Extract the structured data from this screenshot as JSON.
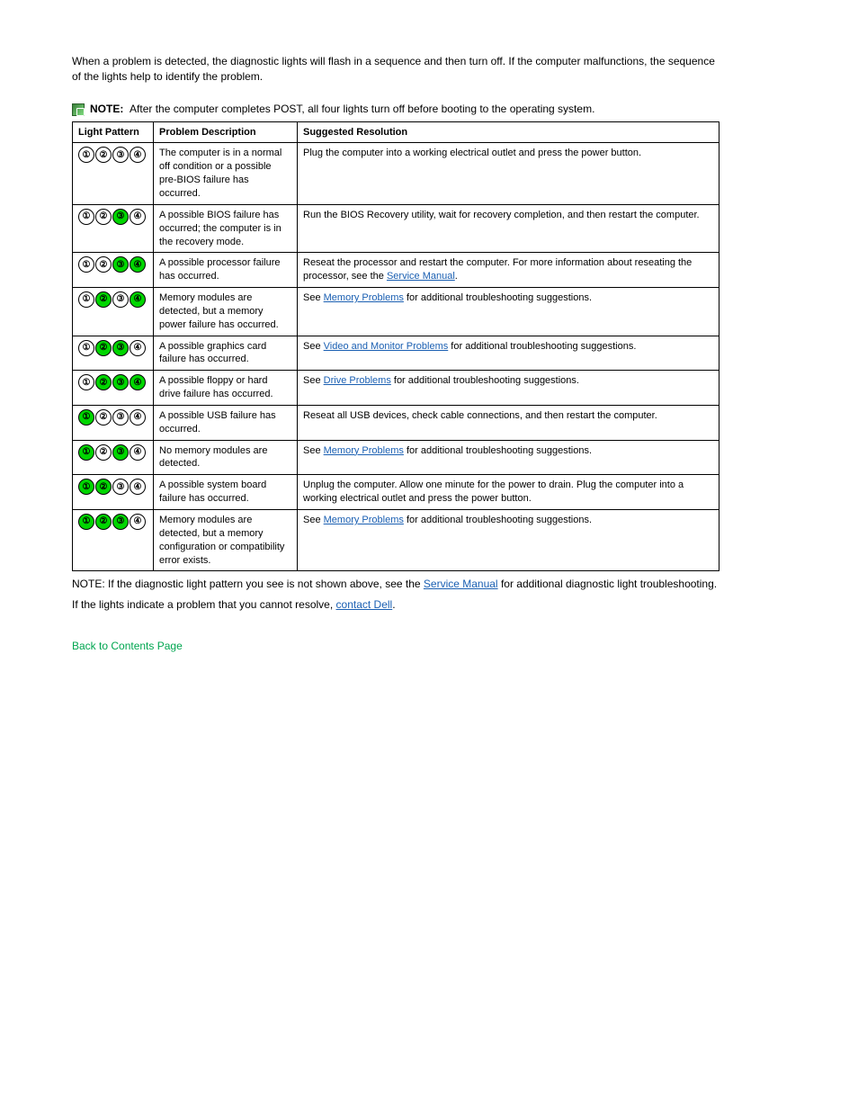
{
  "intro_paragraph": "When a problem is detected, the diagnostic lights will flash in a sequence and then turn off. If the computer malfunctions, the sequence of the lights help to identify the problem.",
  "note": {
    "label": "NOTE:",
    "text": "After the computer completes POST, all four lights turn off before booting to the operating system."
  },
  "table": {
    "headers": {
      "lp": "Light Pattern",
      "desc": "Problem Description",
      "res": "Suggested Resolution"
    },
    "rows": [
      {
        "lights": [
          0,
          0,
          0,
          0
        ],
        "desc": "The computer is in a normal off condition or a possible pre-BIOS failure has occurred.",
        "res": "Plug the computer into a working electrical outlet and press the power button."
      },
      {
        "lights": [
          0,
          0,
          1,
          0
        ],
        "desc": "A possible BIOS failure has occurred; the computer is in the recovery mode.",
        "res_html": "Run the BIOS Recovery utility, wait for recovery completion, and then restart the computer."
      },
      {
        "lights": [
          0,
          0,
          1,
          1
        ],
        "desc": "A possible processor failure has occurred.",
        "res_html": "Reseat the processor and restart the computer. For more information about reseating the processor, see the <span class='link'>Service Manual</span>."
      },
      {
        "lights": [
          0,
          1,
          0,
          1
        ],
        "desc": "Memory modules are detected, but a memory power failure has occurred.",
        "res_html": "See <span class='link'>Memory Problems</span> for additional troubleshooting suggestions."
      },
      {
        "lights": [
          0,
          1,
          1,
          0
        ],
        "desc": "A possible graphics card failure has occurred.",
        "res_html": "See <span class='link'>Video and Monitor Problems</span> for additional troubleshooting suggestions."
      },
      {
        "lights": [
          0,
          1,
          1,
          1
        ],
        "desc": "A possible floppy or hard drive failure has occurred.",
        "res_html": "See <span class='link'>Drive Problems</span> for additional troubleshooting suggestions."
      },
      {
        "lights": [
          1,
          0,
          0,
          0
        ],
        "desc": "A possible USB failure has occurred.",
        "res_html": "Reseat all USB devices, check cable connections, and then restart the computer."
      },
      {
        "lights": [
          1,
          0,
          1,
          0
        ],
        "desc": "No memory modules are detected.",
        "res_html": "See <span class='link'>Memory Problems</span> for additional troubleshooting suggestions."
      },
      {
        "lights": [
          1,
          1,
          0,
          0
        ],
        "desc": "A possible system board failure has occurred.",
        "res_html": "Unplug the computer. Allow one minute for the power to drain. Plug the computer into a working electrical outlet and press the power button."
      },
      {
        "lights": [
          1,
          1,
          1,
          0
        ],
        "desc": "Memory modules are detected, but a memory configuration or compatibility error exists.",
        "res_html": "See <span class='link'>Memory Problems</span> for additional troubleshooting suggestions."
      }
    ]
  },
  "closing_note_html": "NOTE: If the diagnostic light pattern you see is not shown above, see the <span class='link'>Service Manual</span> for additional diagnostic light troubleshooting.",
  "closing_text_html": "If the lights indicate a problem that you cannot resolve, <span class='contact-link'>contact Dell</span>.",
  "back_to_contents": "Back to Contents Page",
  "glyphs": [
    "①",
    "②",
    "③",
    "④"
  ]
}
